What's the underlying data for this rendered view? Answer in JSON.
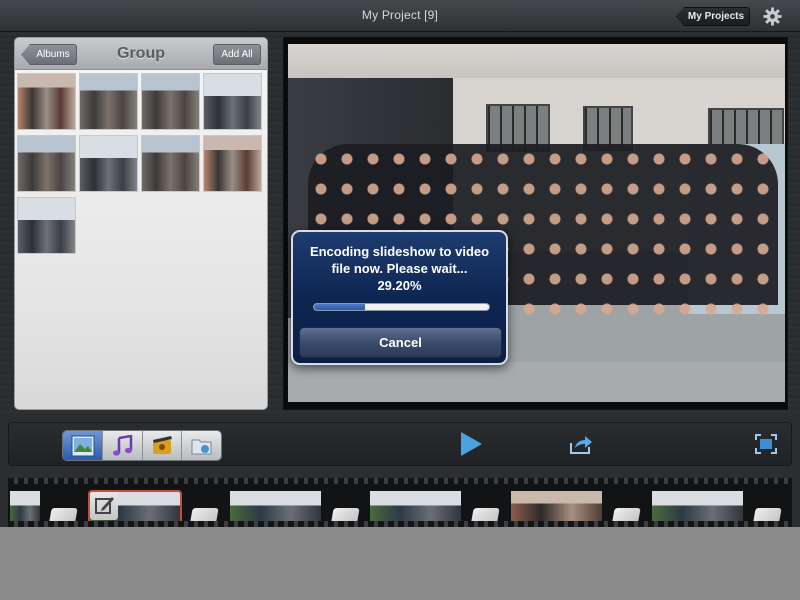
{
  "header": {
    "project_title": "My Project  [9]",
    "my_projects_label": "My Projects",
    "settings_icon": "gear-icon"
  },
  "library": {
    "title": "Group",
    "albums_label": "Albums",
    "add_all_label": "Add All",
    "photo_count": 9
  },
  "dialog": {
    "message_line1": "Encoding slideshow to video",
    "message_line2": "file now. Please wait...",
    "percent_text": "29.20%",
    "progress": 0.292,
    "cancel_label": "Cancel"
  },
  "toolbar": {
    "tabs": [
      {
        "icon": "photos-icon",
        "active": true
      },
      {
        "icon": "music-icon",
        "active": false
      },
      {
        "icon": "effects-icon",
        "active": false
      },
      {
        "icon": "export-folder-icon",
        "active": false
      }
    ],
    "play_icon": "play-icon",
    "share_icon": "share-icon",
    "fullscreen_icon": "fullscreen-icon"
  },
  "colors": {
    "accent": "#2a5cae",
    "dialog_bg": "#0e2652",
    "play": "#4aa3df",
    "selected_frame": "#c0503a"
  }
}
